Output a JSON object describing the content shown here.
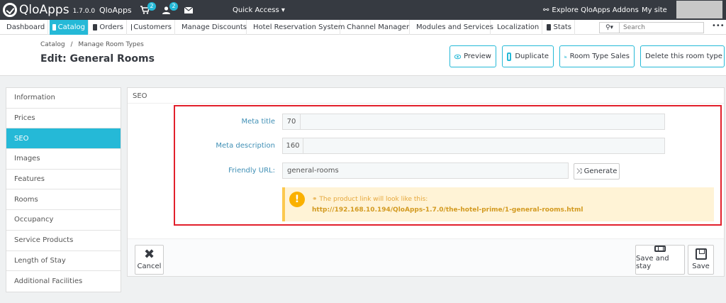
{
  "topbar": {
    "brand": "QloApps",
    "version": "1.7.0.0",
    "shop_name": "QloApps",
    "cart_badge": "2",
    "user_badge": "2",
    "quick_access": "Quick Access ▾",
    "explore": "Explore QloApps Addons",
    "my_site": "My site"
  },
  "menu": {
    "items": [
      {
        "label": "Dashboard"
      },
      {
        "label": "Catalog"
      },
      {
        "label": "Orders"
      },
      {
        "label": "Customers"
      },
      {
        "label": "Manage Discounts"
      },
      {
        "label": "Hotel Reservation System"
      },
      {
        "label": "Channel Manager"
      },
      {
        "label": "Modules and Services"
      },
      {
        "label": "Localization"
      },
      {
        "label": "Stats"
      }
    ],
    "search_placeholder": "Search",
    "more": "•••"
  },
  "header": {
    "breadcrumb_root": "Catalog",
    "breadcrumb_sep": "/",
    "breadcrumb_current": "Manage Room Types",
    "title": "Edit: General Rooms",
    "buttons": {
      "preview": "Preview",
      "duplicate": "Duplicate",
      "sales": "Room Type Sales",
      "delete": "Delete this room type"
    }
  },
  "sidebar": {
    "items": [
      {
        "label": "Information"
      },
      {
        "label": "Prices"
      },
      {
        "label": "SEO"
      },
      {
        "label": "Images"
      },
      {
        "label": "Features"
      },
      {
        "label": "Rooms"
      },
      {
        "label": "Occupancy"
      },
      {
        "label": "Service Products"
      },
      {
        "label": "Length of Stay"
      },
      {
        "label": "Additional Facilities"
      }
    ],
    "active_index": 2
  },
  "seo": {
    "panel_title": "SEO",
    "meta_title": {
      "label": "Meta title",
      "counter": "70",
      "value": ""
    },
    "meta_description": {
      "label": "Meta description",
      "counter": "160",
      "value": ""
    },
    "friendly_url": {
      "label": "Friendly URL:",
      "value": "general-rooms"
    },
    "generate_label": "Generate",
    "alert_line1": "The product link will look like this:",
    "alert_url": "http://192.168.10.194/QloApps-1.7.0/the-hotel-prime/1-general-rooms.html"
  },
  "footer": {
    "cancel": "Cancel",
    "save_stay": "Save and stay",
    "save": "Save"
  },
  "colors": {
    "accent": "#25b9d7",
    "topbar": "#363a41",
    "highlight_border": "#e2202c",
    "alert_bg": "#fff3d6"
  }
}
